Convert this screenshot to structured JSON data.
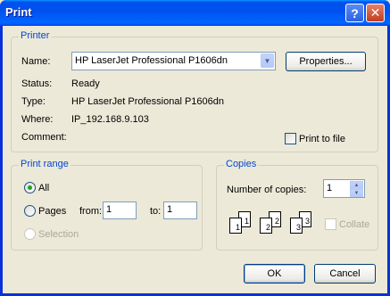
{
  "window": {
    "title": "Print",
    "help_label": "?",
    "close_label": "✕"
  },
  "printer": {
    "legend": "Printer",
    "name_label": "Name:",
    "name_value": "HP LaserJet Professional P1606dn",
    "properties_label": "Properties...",
    "status_label": "Status:",
    "status_value": "Ready",
    "type_label": "Type:",
    "type_value": "HP LaserJet Professional P1606dn",
    "where_label": "Where:",
    "where_value": "IP_192.168.9.103",
    "comment_label": "Comment:",
    "print_to_file_label": "Print to file"
  },
  "print_range": {
    "legend": "Print range",
    "all_label": "All",
    "pages_label": "Pages",
    "from_label": "from:",
    "from_value": "1",
    "to_label": "to:",
    "to_value": "1",
    "selection_label": "Selection"
  },
  "copies": {
    "legend": "Copies",
    "number_label": "Number of copies:",
    "number_value": "1",
    "collate_label": "Collate",
    "page_numbers": [
      "1",
      "1",
      "2",
      "2",
      "3",
      "3"
    ]
  },
  "buttons": {
    "ok_label": "OK",
    "cancel_label": "Cancel"
  },
  "icons": {
    "dropdown": "chevron-down-icon",
    "spin_up": "spin-up-icon",
    "spin_down": "spin-down-icon"
  },
  "colors": {
    "title_bar": "#0054e3",
    "group_legend": "#0046d5",
    "dialog_bg": "#ece9d8"
  }
}
